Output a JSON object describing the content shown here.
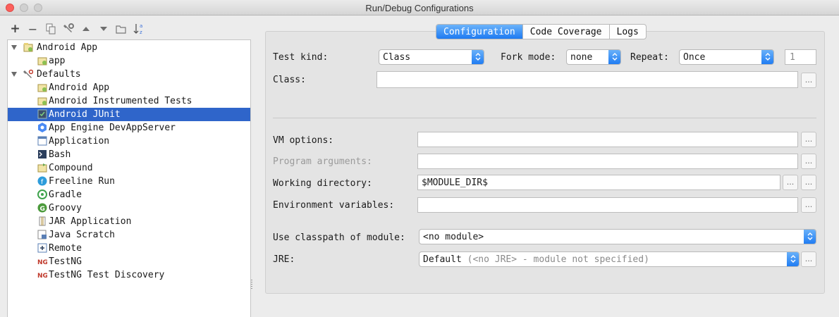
{
  "window": {
    "title": "Run/Debug Configurations"
  },
  "toolbar": {
    "add": "+",
    "remove": "−",
    "items": [
      "copy-icon",
      "wrench-icon",
      "move-up-icon",
      "move-down-icon",
      "folder-icon",
      "sort-alpha-icon"
    ]
  },
  "tree": {
    "groups": [
      {
        "label": "Android App",
        "expanded": true,
        "children": [
          {
            "label": "app"
          }
        ]
      },
      {
        "label": "Defaults",
        "expanded": true,
        "children": [
          {
            "label": "Android App"
          },
          {
            "label": "Android Instrumented Tests"
          },
          {
            "label": "Android JUnit",
            "selected": true
          },
          {
            "label": "App Engine DevAppServer"
          },
          {
            "label": "Application"
          },
          {
            "label": "Bash"
          },
          {
            "label": "Compound"
          },
          {
            "label": "Freeline Run"
          },
          {
            "label": "Gradle"
          },
          {
            "label": "Groovy"
          },
          {
            "label": "JAR Application"
          },
          {
            "label": "Java Scratch"
          },
          {
            "label": "Remote"
          },
          {
            "label": "TestNG"
          },
          {
            "label": "TestNG Test Discovery"
          }
        ]
      }
    ]
  },
  "tabs": {
    "configuration": "Configuration",
    "code_coverage": "Code Coverage",
    "logs": "Logs"
  },
  "form": {
    "test_kind_label": "Test kind:",
    "test_kind_value": "Class",
    "fork_mode_label": "Fork mode:",
    "fork_mode_value": "none",
    "repeat_label": "Repeat:",
    "repeat_value": "Once",
    "repeat_count": "1",
    "class_label": "Class:",
    "class_value": "",
    "vm_options_label": "VM options:",
    "vm_options_value": "",
    "program_args_label": "Program arguments:",
    "program_args_value": "",
    "working_dir_label": "Working directory:",
    "working_dir_value": "$MODULE_DIR$",
    "env_vars_label": "Environment variables:",
    "env_vars_value": "",
    "classpath_label": "Use classpath of module:",
    "classpath_value": "<no module>",
    "jre_label": "JRE:",
    "jre_value": "Default",
    "jre_hint": "(<no JRE> - module not specified)",
    "browse": "..."
  },
  "colors": {
    "selection": "#2f65ca",
    "accent": "#1d7af2"
  }
}
